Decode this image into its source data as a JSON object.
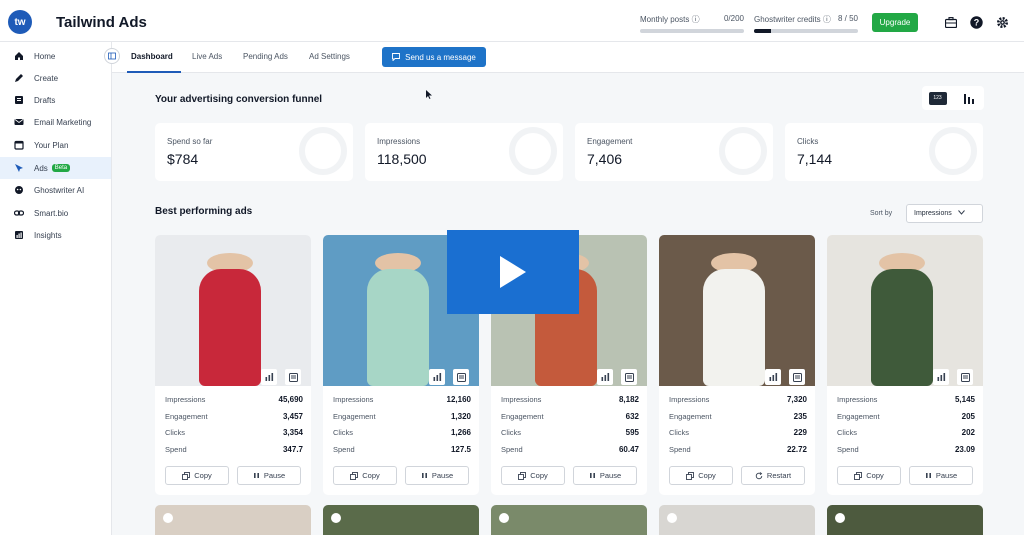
{
  "app": {
    "logo_text": "tw",
    "title": "Tailwind Ads"
  },
  "header": {
    "monthly_posts": {
      "label": "Monthly posts",
      "value": "0/200",
      "progress": 0
    },
    "ghostwriter": {
      "label": "Ghostwriter credits",
      "value": "8 / 50",
      "progress": 0.16
    },
    "upgrade_label": "Upgrade"
  },
  "sidebar": {
    "items": [
      {
        "label": "Home",
        "icon": "home-icon"
      },
      {
        "label": "Create",
        "icon": "pencil-icon"
      },
      {
        "label": "Drafts",
        "icon": "drafts-icon"
      },
      {
        "label": "Email Marketing",
        "icon": "email-icon"
      },
      {
        "label": "Your Plan",
        "icon": "calendar-icon"
      },
      {
        "label": "Ads",
        "icon": "ads-icon",
        "badge": "Beta"
      },
      {
        "label": "Ghostwriter AI",
        "icon": "ghostwriter-icon"
      },
      {
        "label": "Smart.bio",
        "icon": "link-icon"
      },
      {
        "label": "Insights",
        "icon": "chart-icon"
      }
    ]
  },
  "tabs": [
    {
      "label": "Dashboard"
    },
    {
      "label": "Live Ads"
    },
    {
      "label": "Pending Ads"
    },
    {
      "label": "Ad Settings"
    }
  ],
  "message_button": "Send us a message",
  "funnel": {
    "title": "Your advertising conversion funnel",
    "toggle_number_label": "123",
    "stats": [
      {
        "label": "Spend so far",
        "value": "$784"
      },
      {
        "label": "Impressions",
        "value": "118,500"
      },
      {
        "label": "Engagement",
        "value": "7,406"
      },
      {
        "label": "Clicks",
        "value": "7,144"
      }
    ]
  },
  "best": {
    "title": "Best performing ads",
    "sort_label": "Sort by",
    "sort_value": "Impressions",
    "metric_labels": {
      "impressions": "Impressions",
      "engagement": "Engagement",
      "clicks": "Clicks",
      "spend": "Spend"
    },
    "ads": [
      {
        "impressions": "45,690",
        "engagement": "3,457",
        "clicks": "3,354",
        "spend": "347.7",
        "copy": "Copy",
        "action": "Pause",
        "dress_color": "#c8283a",
        "bg": "#e9ebee"
      },
      {
        "impressions": "12,160",
        "engagement": "1,320",
        "clicks": "1,266",
        "spend": "127.5",
        "copy": "Copy",
        "action": "Pause",
        "dress_color": "#a7d6c6",
        "bg": "#5f9cc4"
      },
      {
        "impressions": "8,182",
        "engagement": "632",
        "clicks": "595",
        "spend": "60.47",
        "copy": "Copy",
        "action": "Pause",
        "dress_color": "#c45a3c",
        "bg": "#b9c2b3"
      },
      {
        "impressions": "7,320",
        "engagement": "235",
        "clicks": "229",
        "spend": "22.72",
        "copy": "Copy",
        "action": "Restart",
        "dress_color": "#f2f2ee",
        "bg": "#6b5a4a"
      },
      {
        "impressions": "5,145",
        "engagement": "205",
        "clicks": "202",
        "spend": "23.09",
        "copy": "Copy",
        "action": "Pause",
        "dress_color": "#3f5a3a",
        "bg": "#e6e4df"
      }
    ]
  },
  "colors": {
    "brand": "#1e5bb8",
    "upgrade": "#22a845",
    "play_overlay": "#1a6fd1"
  }
}
